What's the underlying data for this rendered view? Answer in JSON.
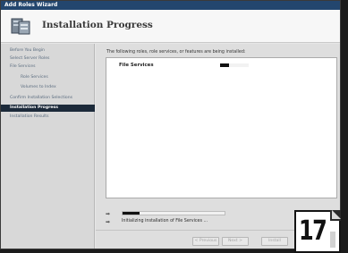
{
  "window": {
    "title": "Add Roles Wizard"
  },
  "header": {
    "title": "Installation Progress",
    "icon": "server-roles-icon"
  },
  "sidebar": {
    "items": [
      {
        "label": "Before You Begin",
        "sub": false,
        "active": false
      },
      {
        "label": "Select Server Roles",
        "sub": false,
        "active": false
      },
      {
        "label": "File Services",
        "sub": false,
        "active": false
      },
      {
        "label": "Role Services",
        "sub": true,
        "active": false
      },
      {
        "label": "Volumes to Index",
        "sub": true,
        "active": false
      },
      {
        "label": "Confirm Installation Selections",
        "sub": false,
        "active": false
      },
      {
        "label": "Installation Progress",
        "sub": false,
        "active": true
      },
      {
        "label": "Installation Results",
        "sub": false,
        "active": false
      }
    ]
  },
  "main": {
    "intro": "The following roles, role services, or features are being installed:",
    "rows": [
      {
        "label": "File Services",
        "progress": 0.3
      }
    ],
    "overall_progress": 0.17,
    "status": "Initializing installation of File Services ..."
  },
  "buttons": {
    "previous": "< Previous",
    "next": "Next >",
    "install": "Install"
  },
  "step_badge": "17",
  "colors": {
    "accent": "#1c2a3a",
    "titlebar": "#23466e"
  }
}
